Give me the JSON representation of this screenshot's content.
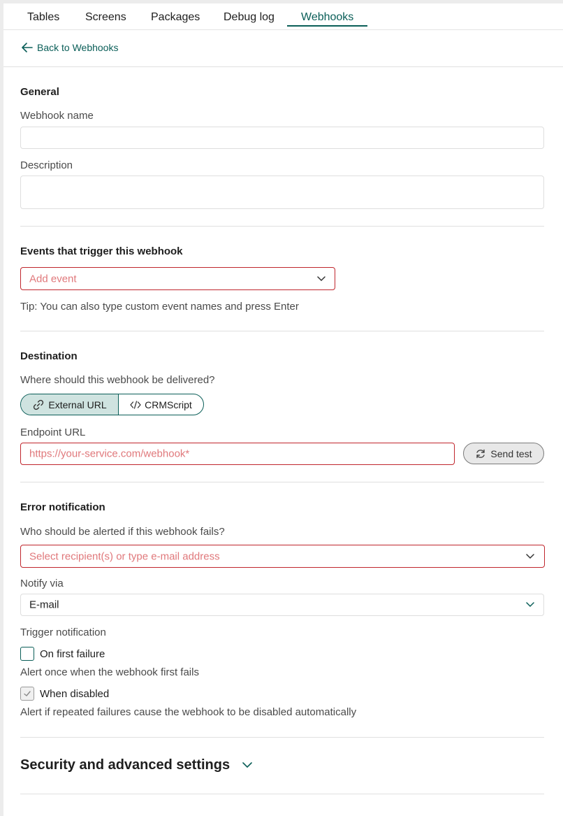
{
  "tabs": [
    {
      "label": "Tables"
    },
    {
      "label": "Screens"
    },
    {
      "label": "Packages"
    },
    {
      "label": "Debug log"
    },
    {
      "label": "Webhooks"
    }
  ],
  "back_link": "Back to Webhooks",
  "general": {
    "title": "General",
    "name_label": "Webhook name",
    "description_label": "Description"
  },
  "events": {
    "title": "Events that trigger this webhook",
    "placeholder": "Add event",
    "tip": "Tip: You can also type custom event names and press Enter"
  },
  "destination": {
    "title": "Destination",
    "question": "Where should this webhook be delivered?",
    "options": [
      "External URL",
      "CRMScript"
    ],
    "selected": "External URL",
    "endpoint_label": "Endpoint URL",
    "endpoint_placeholder": "https://your-service.com/webhook*",
    "send_test": "Send test"
  },
  "error_notification": {
    "title": "Error notification",
    "question": "Who should be alerted if this webhook fails?",
    "recipient_placeholder": "Select recipient(s) or type e-mail address",
    "notify_via_label": "Notify via",
    "notify_via_value": "E-mail",
    "trigger_label": "Trigger notification",
    "first_failure_label": "On first failure",
    "first_failure_hint": "Alert once when the webhook first fails",
    "first_failure_checked": false,
    "disabled_label": "When disabled",
    "disabled_hint": "Alert if repeated failures cause the webhook to be disabled automatically",
    "disabled_checked": true
  },
  "advanced": {
    "title": "Security and advanced settings"
  },
  "colors": {
    "accent": "#0a5e58",
    "error": "#c0262d",
    "placeholder_error": "#e0787b"
  }
}
